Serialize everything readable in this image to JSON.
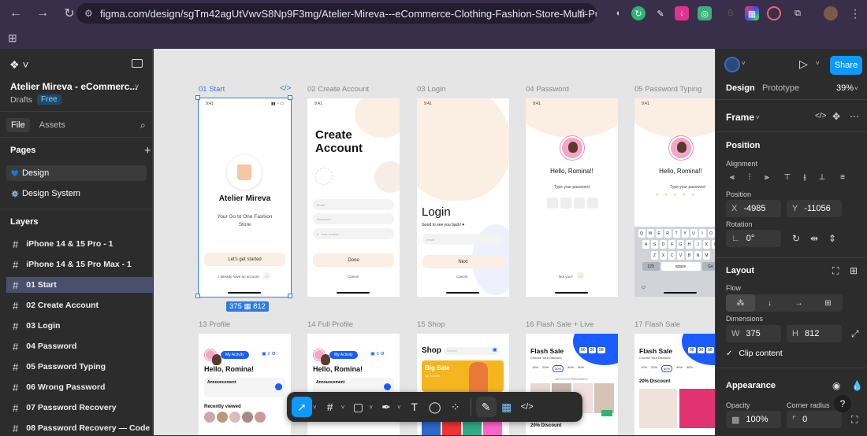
{
  "browser": {
    "url": "figma.com/design/sgTm42agUtVwvS8Np9F3mg/Atelier-Mireva---eCommerce-Clothing-Fashion-Store-Multi-Purpose-..."
  },
  "left_panel": {
    "project_title": "Atelier Mireva - eCommerc...",
    "drafts_label": "Drafts",
    "plan_badge": "Free",
    "tabs": [
      "File",
      "Assets"
    ],
    "pages_title": "Pages",
    "pages": [
      {
        "icon": "💙",
        "label": "Design"
      },
      {
        "icon": "⚙️",
        "label": "Design System"
      }
    ],
    "layers_title": "Layers",
    "layers": [
      "iPhone 14 & 15 Pro - 1",
      "iPhone 14 & 15 Pro Max - 1",
      "01 Start",
      "02 Create Account",
      "03 Login",
      "04 Password",
      "05 Password Typing",
      "06 Wrong Password",
      "07 Password Recovery",
      "08 Password Recovery — Code"
    ],
    "active_layer_index": 2
  },
  "canvas": {
    "frame_labels_row1": [
      "01 Start",
      "02 Create Account",
      "03 Login",
      "04 Password",
      "05 Password Typing"
    ],
    "frame_labels_row2": [
      "13 Profile",
      "14 Full Profile",
      "15 Shop",
      "16 Flash Sale + Live",
      "17 Flash Sale"
    ],
    "selection_badge": "375 ▦ 812",
    "start": {
      "time": "9:41",
      "title": "Atelier Mireva",
      "subtitle": "Your Go to One Fashion Store",
      "cta": "Let's get started",
      "already": "I already have an account"
    },
    "create": {
      "time": "9:41",
      "title": "Create Account",
      "email_ph": "Email",
      "password_ph": "Password",
      "phone_ph": "Your number",
      "done": "Done",
      "cancel": "Cancel"
    },
    "login": {
      "time": "9:41",
      "title": "Login",
      "subtitle": "Good to see you back! ♥",
      "email_ph": "Email",
      "next": "Next",
      "cancel": "Cancel"
    },
    "password": {
      "time": "9:41",
      "hello": "Hello, Romina!!",
      "type": "Type your password",
      "not_you": "Not you?"
    },
    "password_typing": {
      "time": "9:41",
      "hello": "Hello, Romina!!",
      "type": "Type your password",
      "kb_row1": [
        "Q",
        "W",
        "E",
        "R",
        "T",
        "Y",
        "U",
        "I",
        "O",
        "P"
      ],
      "kb_row2": [
        "A",
        "S",
        "D",
        "F",
        "G",
        "H",
        "J",
        "K",
        "L"
      ],
      "kb_row3": [
        "Z",
        "X",
        "C",
        "V",
        "B",
        "N",
        "M"
      ],
      "kb_num": "123",
      "kb_space": "space",
      "kb_go": "Go"
    },
    "profile": {
      "my_activity": "My Activity",
      "hello": "Hello, Romina!",
      "announcement": "Announcement",
      "recently_viewed": "Recently viewed"
    },
    "shop": {
      "title": "Shop",
      "search_ph": "Search",
      "big_sale": "Big Sale",
      "up_to": "Up to 50%"
    },
    "flash_live": {
      "title": "Flash Sale",
      "sub": "Choose Your Discount",
      "timer": [
        "00",
        "36",
        "58"
      ],
      "discounts": [
        "10%",
        "20%",
        "30%",
        "40%",
        "50%"
      ],
      "section": "20% Discount",
      "arrivals": "ARTICLES REMAINED"
    },
    "flash": {
      "title": "Flash Sale",
      "sub": "Choose Your Discount",
      "timer": [
        "00",
        "36",
        "58"
      ],
      "discounts": [
        "10%",
        "20%",
        "30%",
        "40%",
        "50%"
      ],
      "section": "20% Discount"
    }
  },
  "right_panel": {
    "share_label": "Share",
    "tabs": [
      "Design",
      "Prototype"
    ],
    "zoom": "39%",
    "frame_label": "Frame",
    "position_title": "Position",
    "alignment_label": "Alignment",
    "position_label": "Position",
    "x_label": "X",
    "x_value": "-4985",
    "y_label": "Y",
    "y_value": "-11056",
    "rotation_label": "Rotation",
    "rotation_value": "0°",
    "layout_title": "Layout",
    "flow_label": "Flow",
    "dimensions_label": "Dimensions",
    "w_label": "W",
    "w_value": "375",
    "h_label": "H",
    "h_value": "812",
    "clip_label": "Clip content",
    "appearance_title": "Appearance",
    "opacity_label": "Opacity",
    "opacity_value": "100%",
    "corner_label": "Corner radius",
    "corner_value": "0"
  },
  "colors": {
    "accent": "#0d99ff",
    "selection": "#2c7be5",
    "chrome": "#3a2f4a",
    "panel": "#2c2c2c",
    "canvas": "#e5e5e5",
    "blue_brand": "#1a5cff",
    "pale": "#fbeee2"
  }
}
